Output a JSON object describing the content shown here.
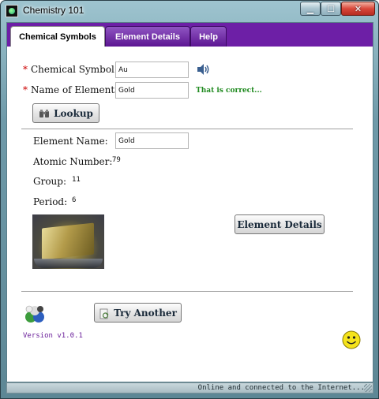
{
  "window": {
    "title": "Chemistry 101"
  },
  "window_buttons": [
    "minimize",
    "maximize",
    "close"
  ],
  "tabs": [
    {
      "label": "Chemical Symbols",
      "active": true
    },
    {
      "label": "Element Details",
      "active": false
    },
    {
      "label": "Help",
      "active": false
    }
  ],
  "form": {
    "symbol_label": "Chemical Symbol:",
    "symbol_value": "Au",
    "name_label": "Name of Element:",
    "name_value": "Gold",
    "required_marker": "*",
    "feedback": "That is correct...",
    "lookup_button": "Lookup"
  },
  "details": {
    "element_name_label": "Element Name:",
    "element_name_value": "Gold",
    "atomic_number_label": "Atomic Number:",
    "atomic_number_value": "79",
    "group_label": "Group:",
    "group_value": "11",
    "period_label": "Period:",
    "period_value": "6",
    "details_button": "Element Details"
  },
  "footer": {
    "try_another_button": "Try Another",
    "version": "Version v1.0.1"
  },
  "statusbar": {
    "text": "Online and connected to the Internet..."
  },
  "icons": {
    "app": "chemistry-app-icon",
    "speaker": "speaker-icon",
    "lookup": "binoculars-icon",
    "try_another": "refresh-document-icon",
    "molecule": "molecule-logo-icon",
    "smiley": "smiley-icon"
  },
  "colors": {
    "tabstrip": "#6d1fa6",
    "feedback": "#1f8a1f",
    "required": "#cc0000",
    "version": "#6a1f9a"
  }
}
